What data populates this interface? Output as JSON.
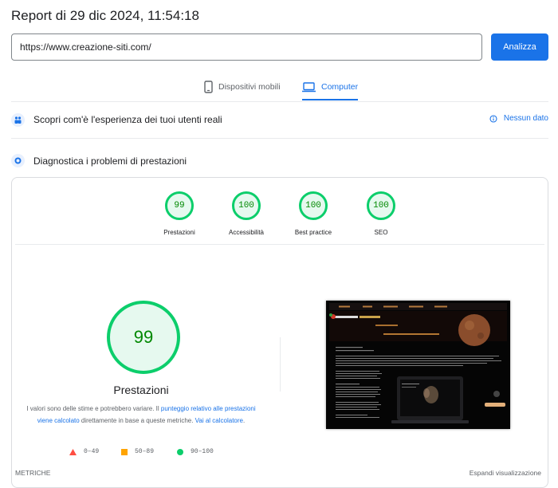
{
  "report": {
    "title": "Report di 29 dic 2024, 11:54:18"
  },
  "search": {
    "url": "https://www.creazione-siti.com/",
    "button": "Analizza"
  },
  "tabs": [
    {
      "label": "Dispositivi mobili",
      "icon": "smartphone-icon",
      "active": false
    },
    {
      "label": "Computer",
      "icon": "laptop-icon",
      "active": true
    }
  ],
  "field_data": {
    "title": "Scopri com'è l'esperienza dei tuoi utenti reali",
    "status": "Nessun dato"
  },
  "diagnostics": {
    "title": "Diagnostica i problemi di prestazioni"
  },
  "categories": [
    {
      "label": "Prestazioni",
      "score": "99"
    },
    {
      "label": "Accessibilità",
      "score": "100"
    },
    {
      "label": "Best practice",
      "score": "100"
    },
    {
      "label": "SEO",
      "score": "100"
    }
  ],
  "performance": {
    "score": "99",
    "label": "Prestazioni",
    "desc_prefix": "I valori sono delle stime e potrebbero variare. Il ",
    "desc_link1": "punteggio relativo alle prestazioni viene calcolato",
    "desc_middle": " direttamente in base a queste metriche. ",
    "desc_link2": "Vai al calcolatore",
    "desc_suffix": "."
  },
  "legend": [
    {
      "range": "0–49",
      "shape": "triangle",
      "color": "#ff4e42"
    },
    {
      "range": "50–89",
      "shape": "square",
      "color": "#ffa400"
    },
    {
      "range": "90–100",
      "shape": "circle",
      "color": "#0cce6b"
    }
  ],
  "colors": {
    "accent": "#1a73e8",
    "pass": "#0cce6b",
    "pass_text": "#008800"
  },
  "footer": {
    "metrics": "METRICHE",
    "expand": "Espandi visualizzazione"
  }
}
